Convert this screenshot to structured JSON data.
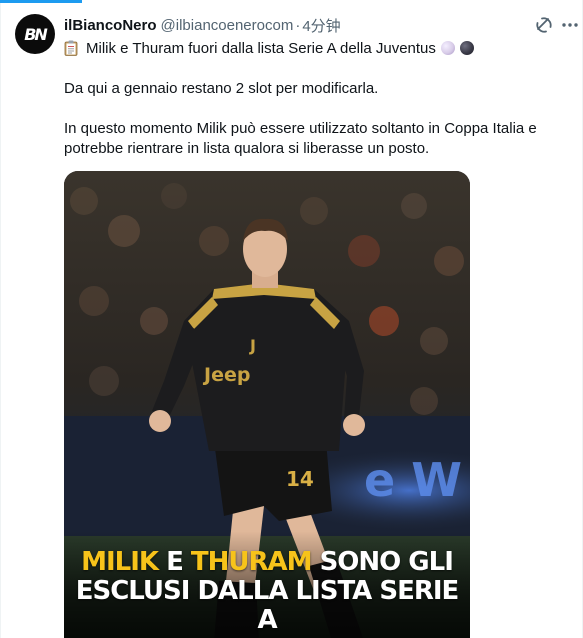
{
  "tweet": {
    "author": {
      "display_name": "ilBiancoNero",
      "handle": "@ilbiancoenerocom",
      "separator": "·",
      "time": "4分钟",
      "avatar_text": "BN"
    },
    "title": "Milik e Thuram fuori dalla lista Serie A della Juventus",
    "paragraphs": [
      "Da qui a gennaio restano 2 slot per modificarla.",
      "In questo momento Milik può essere utilizzato soltanto in Coppa Italia e potrebbe rientrare in lista qualora si liberasse un posto."
    ],
    "media": {
      "caption_line1_a": "MILIK",
      "caption_line1_b": " E ",
      "caption_line1_c": "THURAM",
      "caption_line1_d": " SONO GLI",
      "caption_line2": "ESCLUSI DALLA LISTA SERIE A",
      "shirt_sponsor": "Jeep",
      "shirt_number": "14",
      "highlight_color": "#f7c31a"
    },
    "icons": {
      "title_prefix": "clipboard-icon",
      "title_suffix_1": "light-moon-icon",
      "title_suffix_2": "dark-moon-icon",
      "grok": "grok-icon",
      "more": "more-icon"
    }
  },
  "colors": {
    "accent": "#1d9bf0",
    "secondary_text": "#536471",
    "primary_text": "#0f1419"
  }
}
